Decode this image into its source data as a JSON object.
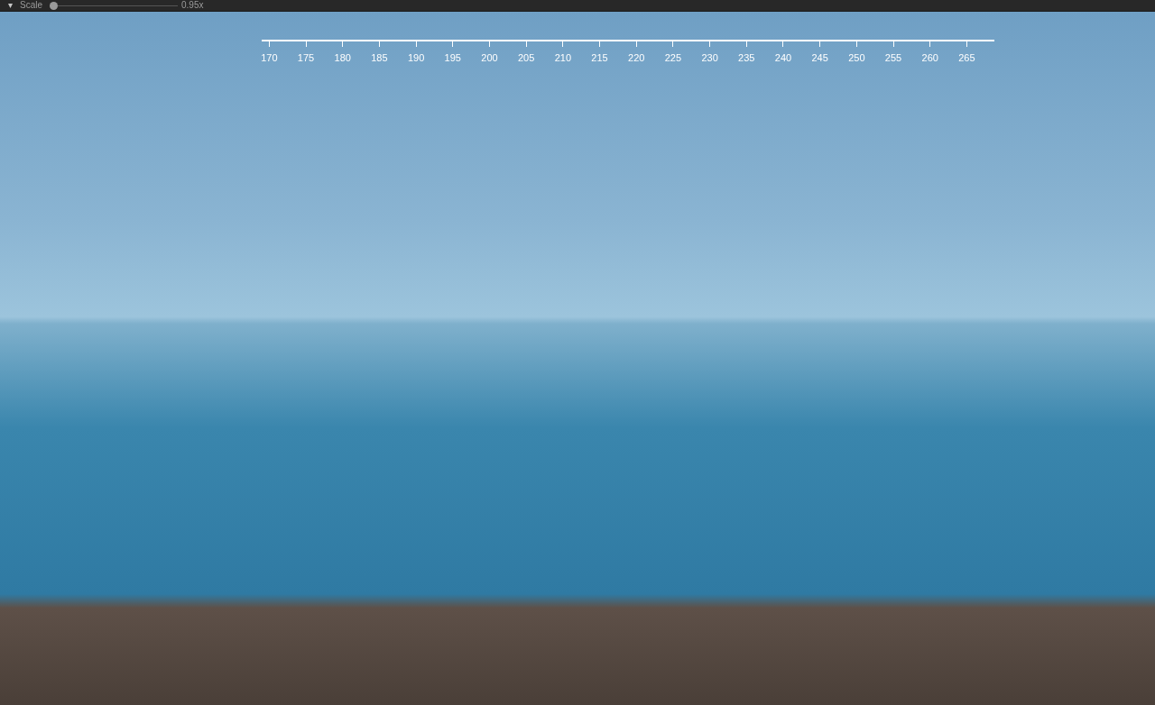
{
  "toolbar": {
    "menu_glyph": "▾",
    "scale_label": "Scale",
    "scale_slider": {
      "level": 0.0
    },
    "scale_reading": "0.95x"
  },
  "heading_ruler": {
    "labels": [
      "170",
      "175",
      "180",
      "185",
      "190",
      "195",
      "200",
      "205",
      "210",
      "215",
      "220",
      "225",
      "230",
      "235",
      "240",
      "245",
      "250",
      "255",
      "260",
      "265"
    ]
  }
}
